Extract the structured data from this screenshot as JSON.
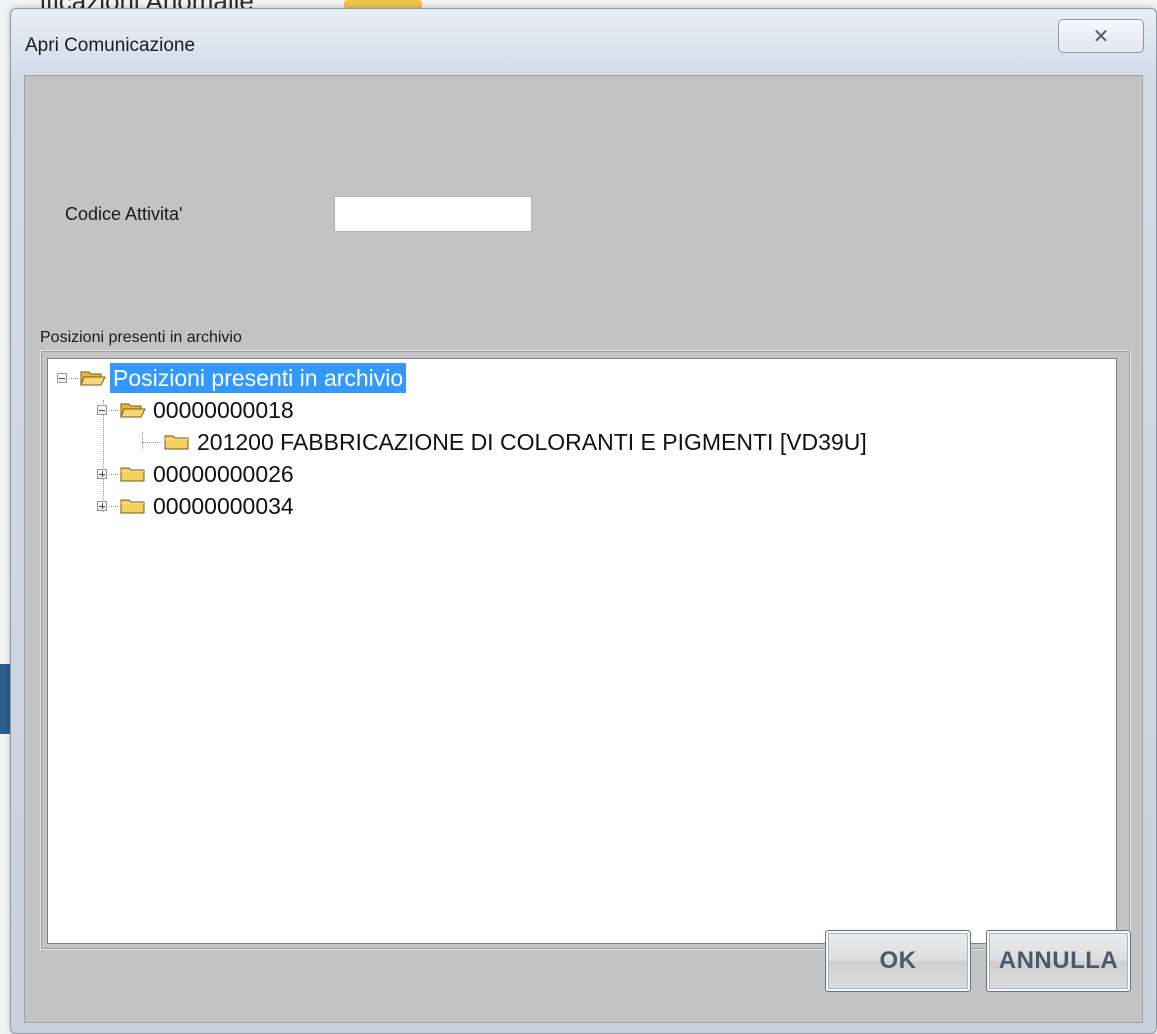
{
  "background": {
    "title_fragment": "ificazioni   Anomalie",
    "colors": {
      "swatch_yellow": "#f1c24b",
      "swatch_blue": "#3c6ea8",
      "accent_left": "#2e5f8e"
    }
  },
  "dialog": {
    "title": "Apri Comunicazione",
    "close_icon": "close-icon",
    "close_glyph": "✕",
    "field": {
      "label": "Codice Attivita'",
      "value": "",
      "placeholder": ""
    },
    "group": {
      "legend": "Posizioni presenti in archivio"
    },
    "tree": {
      "root": {
        "label": "Posizioni presenti in archivio",
        "expanded": true,
        "selected": true
      },
      "children": [
        {
          "label": "00000000018",
          "expanded": true,
          "children": [
            {
              "label": "201200 FABBRICAZIONE DI COLORANTI E PIGMENTI [VD39U]"
            }
          ]
        },
        {
          "label": "00000000026",
          "expanded": false
        },
        {
          "label": "00000000034",
          "expanded": false
        }
      ]
    },
    "buttons": {
      "ok": "OK",
      "cancel": "ANNULLA"
    },
    "colors": {
      "client_bg": "#c3c3c3",
      "selection": "#3399ff",
      "folder": "#f4cf5e"
    }
  }
}
